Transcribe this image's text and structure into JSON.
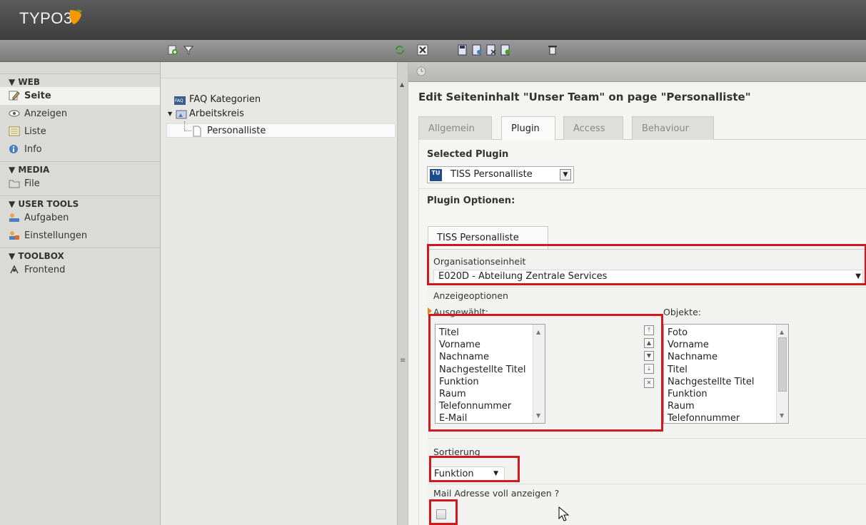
{
  "app": {
    "logo_text": "TYPO3"
  },
  "modules": {
    "sections": [
      {
        "title": "▼ WEB",
        "items": [
          {
            "label": "Seite",
            "icon": "page-edit-icon",
            "active": true
          },
          {
            "label": "Anzeigen",
            "icon": "eye-icon"
          },
          {
            "label": "Liste",
            "icon": "list-icon"
          },
          {
            "label": "Info",
            "icon": "info-icon"
          }
        ]
      },
      {
        "title": "▼ MEDIA",
        "items": [
          {
            "label": "File",
            "icon": "folder-icon"
          }
        ]
      },
      {
        "title": "▼ USER TOOLS",
        "items": [
          {
            "label": "Aufgaben",
            "icon": "tasks-icon"
          },
          {
            "label": "Einstellungen",
            "icon": "user-settings-icon"
          }
        ]
      },
      {
        "title": "▼ TOOLBOX",
        "items": [
          {
            "label": "Frontend",
            "icon": "frontend-icon"
          }
        ]
      }
    ]
  },
  "tree": {
    "items": [
      "FAQ Kategorien",
      "Arbeitskreis",
      "Personalliste"
    ]
  },
  "editor": {
    "title": "Edit Seiteninhalt \"Unser Team\" on page \"Personalliste\"",
    "tabs": [
      "Allgemein",
      "Plugin",
      "Access",
      "Behaviour"
    ],
    "active_tab": "Plugin",
    "selected_plugin_label": "Selected Plugin",
    "plugin_value": "TISS Personalliste",
    "plugin_badge": "TU",
    "plugin_options_label": "Plugin Optionen:",
    "subtab": "TISS Personalliste",
    "org_label": "Organisationseinheit",
    "org_value": "E020D - Abteilung Zentrale Services",
    "display_options_label": "Anzeigeoptionen",
    "selected_label": "Ausgewählt:",
    "selected_items": [
      "Titel",
      "Vorname",
      "Nachname",
      "Nachgestellte Titel",
      "Funktion",
      "Raum",
      "Telefonnummer",
      "E-Mail"
    ],
    "objects_label": "Objekte:",
    "object_items": [
      "Foto",
      "Vorname",
      "Nachname",
      "Titel",
      "Nachgestellte Titel",
      "Funktion",
      "Raum",
      "Telefonnummer"
    ],
    "sort_label": "Sortierung",
    "sort_value": "Funktion",
    "mail_label": "Mail Adresse voll anzeigen ?"
  },
  "colors": {
    "highlight": "#d0191f"
  }
}
